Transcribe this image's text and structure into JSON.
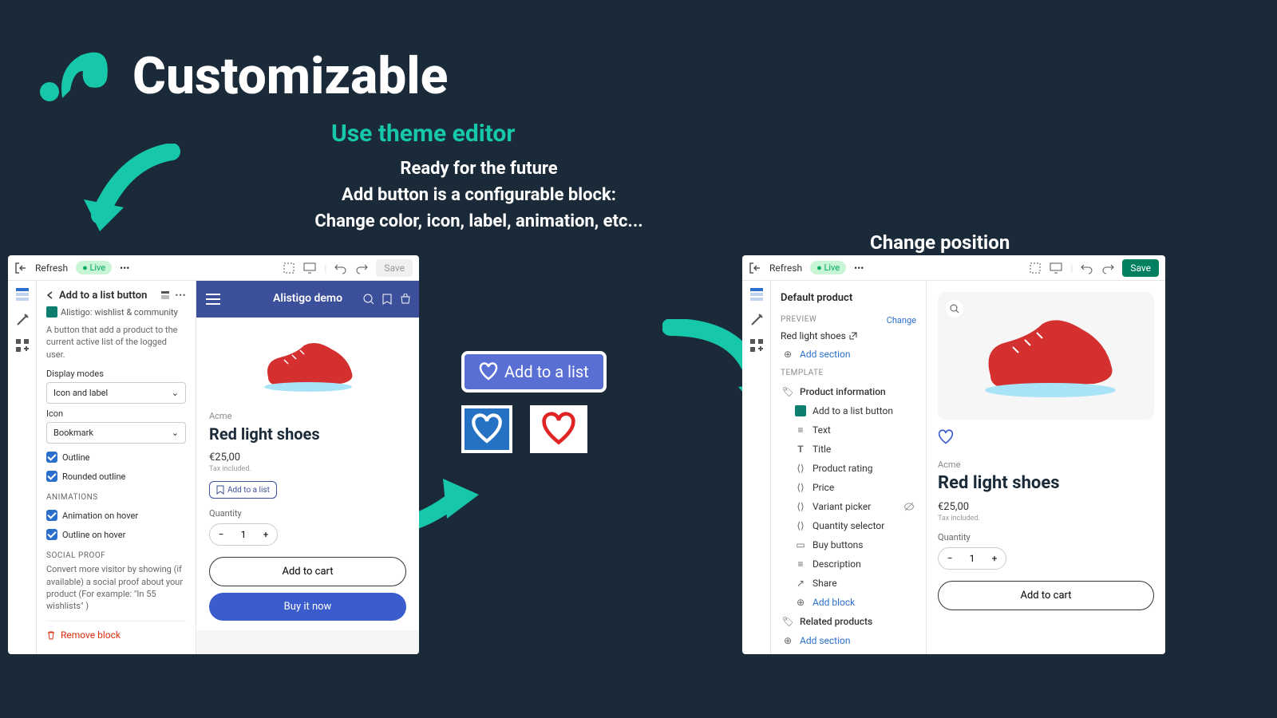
{
  "hero": {
    "title": "Customizable",
    "subtitle": "Use theme editor",
    "desc_line1": "Ready for the future",
    "desc_line2": "Add button is a configurable block:",
    "desc_line3": "Change color, icon, label, animation, etc...",
    "change_position": "Change position"
  },
  "editor": {
    "refresh": "Refresh",
    "live": "Live",
    "save": "Save",
    "more": "•••"
  },
  "sidebar_left": {
    "back_title": "Add to a list button",
    "app_name": "Alistigo: wishlist & community",
    "desc": "A button that add a product to the current active list of the logged user.",
    "display_modes_label": "Display modes",
    "display_modes_value": "Icon and label",
    "icon_label": "Icon",
    "icon_value": "Bookmark",
    "outline": "Outline",
    "rounded_outline": "Rounded outline",
    "animations_section": "ANIMATIONS",
    "animation_hover": "Animation on hover",
    "outline_hover": "Outline on hover",
    "social_section": "SOCIAL PROOF",
    "social_desc": "Convert more visitor by showing (if available) a social proof about your product (For example: \"In 55 wishlists\" )",
    "remove": "Remove block"
  },
  "preview_left": {
    "shop_name": "Alistigo demo",
    "brand": "Acme",
    "product": "Red light shoes",
    "price": "€25,00",
    "tax": "Tax included.",
    "add_list": "Add to a list",
    "quantity": "Quantity",
    "qty_val": "1",
    "add_cart": "Add to cart",
    "buy_now": "Buy it now"
  },
  "demo": {
    "add_to_list": "Add to a list"
  },
  "sidebar_right": {
    "title": "Default product",
    "preview_label": "PREVIEW",
    "change": "Change",
    "preview_product": "Red light shoes",
    "add_section": "Add section",
    "template_label": "TEMPLATE",
    "items": {
      "product_info": "Product information",
      "add_list_btn": "Add to a list button",
      "text": "Text",
      "title": "Title",
      "rating": "Product rating",
      "price": "Price",
      "variant": "Variant picker",
      "qty": "Quantity selector",
      "buy": "Buy buttons",
      "desc": "Description",
      "share": "Share",
      "add_block": "Add block",
      "related": "Related products"
    }
  },
  "preview_right": {
    "brand": "Acme",
    "product": "Red light shoes",
    "price": "€25,00",
    "tax": "Tax included.",
    "quantity": "Quantity",
    "qty_val": "1",
    "add_cart": "Add to cart"
  },
  "colors": {
    "accent": "#16c7aa",
    "shop_blue": "#3b4f9a",
    "link_blue": "#2c6ecb"
  }
}
